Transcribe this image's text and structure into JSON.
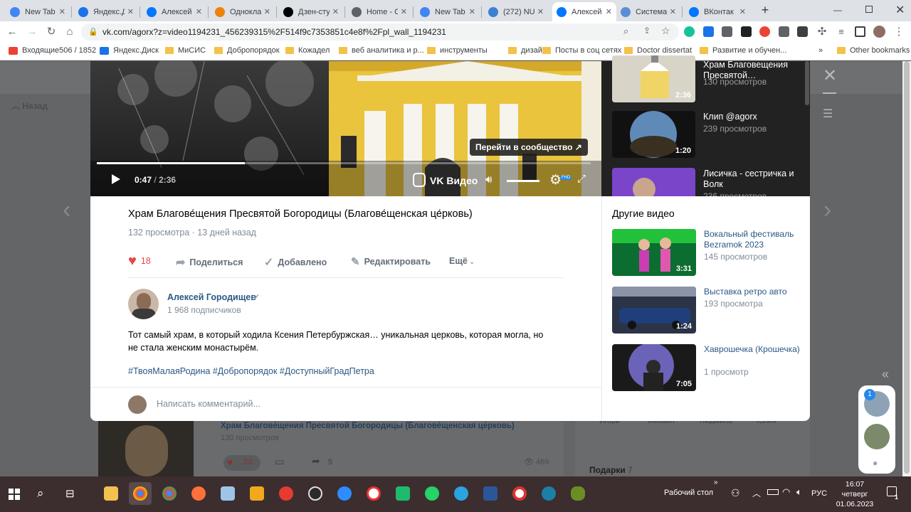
{
  "tabs": [
    {
      "title": "New Tab",
      "icon": "chrome-icon",
      "color": "#4285f4"
    },
    {
      "title": "Яндекс.Д",
      "icon": "yandex-disk-icon",
      "color": "#1a73e8"
    },
    {
      "title": "Алексей",
      "icon": "vk-icon",
      "color": "#0077ff"
    },
    {
      "title": "Однокла",
      "icon": "ok-icon",
      "color": "#ee8208"
    },
    {
      "title": "Дзен-сту",
      "icon": "dzen-icon",
      "color": "#000000"
    },
    {
      "title": "Home - C",
      "icon": "globe-icon",
      "color": "#5f6368"
    },
    {
      "title": "New Tab",
      "icon": "chrome-icon",
      "color": "#4285f4"
    },
    {
      "title": "(272) NU",
      "icon": "notion-icon",
      "color": "#3f7fd0"
    },
    {
      "title": "Алексей",
      "icon": "vk-icon",
      "color": "#0077ff"
    },
    {
      "title": "Система",
      "icon": "system-icon",
      "color": "#5a8dd6"
    },
    {
      "title": "ВКонтак",
      "icon": "vk-icon",
      "color": "#0077ff"
    }
  ],
  "url": "vk.com/agorx?z=video1194231_456239315%2F514f9c7353851c4e8f%2Fpl_wall_1194231",
  "bookmarks": [
    {
      "label": "Входящие506 / 1852",
      "icon": "gmail-icon"
    },
    {
      "label": "Яндекс.Диск",
      "icon": "yandex-disk-icon"
    },
    {
      "label": "МиСИС",
      "icon": "folder-icon"
    },
    {
      "label": "Добропорядок",
      "icon": "folder-icon"
    },
    {
      "label": "Кожадел",
      "icon": "folder-icon"
    },
    {
      "label": "веб аналитика и р...",
      "icon": "folder-icon"
    },
    {
      "label": "инструменты",
      "icon": "folder-icon"
    },
    {
      "label": "дизайн",
      "icon": "folder-icon"
    },
    {
      "label": "Посты в соц сетях",
      "icon": "folder-icon"
    },
    {
      "label": "Doctor dissertat",
      "icon": "folder-icon"
    },
    {
      "label": "Развитие и обучен...",
      "icon": "folder-icon"
    }
  ],
  "other_bookmarks": "Other bookmarks",
  "bookmarks_more": "»",
  "player": {
    "time_current": "0:47",
    "time_sep": "/",
    "time_total": "2:36",
    "community_btn": "Перейти в сообщество ↗",
    "brand": "VK Видео",
    "quality": "FHD",
    "progress": 0.3,
    "volume": 1.0
  },
  "playlist_top": [
    {
      "title": "Храм Благовещения Пресвятой…",
      "views": "130 просмотров",
      "duration": "2:36"
    },
    {
      "title": "Клип @agorx",
      "views": "239 просмотров",
      "duration": "1:20"
    },
    {
      "title": "Лисичка - сестричка и Волк",
      "views": "236 просмотров",
      "duration": ""
    }
  ],
  "video": {
    "title": "Храм Благове́щения Пресвятой Богородицы (Благове́щенская це́рковь)",
    "views": "132 просмотра",
    "dot": "·",
    "date": "13 дней назад",
    "likes": "18",
    "share": "Поделиться",
    "added": "Добавлено",
    "edit": "Редактировать",
    "more": "Ещё"
  },
  "author": {
    "name": "Алексей Городищев",
    "subs": "1 968 подписчиков"
  },
  "description": "Тот самый храм, в который ходила Ксения Петербуржская… уникальная церковь, которая могла, но не стала женским монастырём.",
  "hashtags": "#ТвояМалаяРодина #Добропорядок #ДоступныйГрадПетра",
  "comment_placeholder": "Написать комментарий...",
  "other_videos_title": "Другие видео",
  "other_videos": [
    {
      "title": "Вокальный фестиваль Bezramok 2023",
      "views": "145 просмотров",
      "duration": "3:31"
    },
    {
      "title": "Выставка ретро авто",
      "views": "193 просмотра",
      "duration": "1:24"
    },
    {
      "title": "Хаврошечка (Крошечка)",
      "views": "1 просмотр",
      "duration": "7:05"
    }
  ],
  "background": {
    "back_label": "Назад",
    "post_title": "Храм Благове́щения Пресвятой Богородицы (Благове́щенская це́рковь)",
    "post_views": "130 просмотров",
    "post_likes": "23",
    "post_shares": "5",
    "post_eye": "469",
    "friends": [
      "Игорь",
      "Михаил",
      "Людмила",
      "Юлия"
    ],
    "gifts_label": "Подарки",
    "gifts_count": "7"
  },
  "chat_badge": "1",
  "collapse_arrows": "«",
  "taskbar": {
    "desktop_label": "Рабочий стол",
    "more": "»",
    "lang": "РУС",
    "time": "16:07",
    "weekday": "четверг",
    "date": "01.06.2023",
    "notify_count": "1"
  }
}
